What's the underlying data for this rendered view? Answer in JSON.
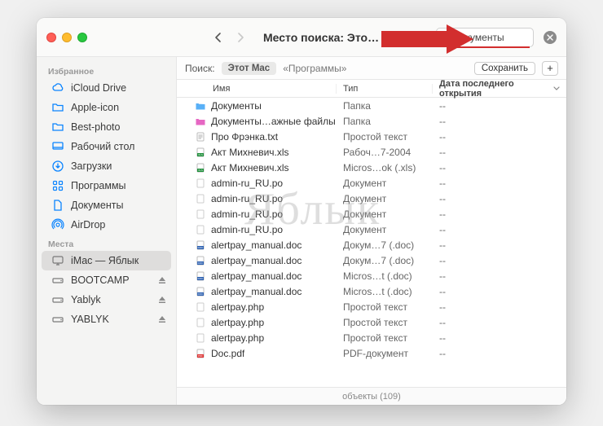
{
  "window": {
    "title": "Место поиска: Это…"
  },
  "search": {
    "value": "документы"
  },
  "scope": {
    "label": "Поиск:",
    "active": "Этот Mac",
    "other": "«Программы»",
    "save": "Сохранить"
  },
  "sidebar": {
    "sections": [
      {
        "title": "Избранное",
        "items": [
          {
            "label": "iCloud Drive",
            "icon": "cloud"
          },
          {
            "label": "Apple-icon",
            "icon": "folder"
          },
          {
            "label": "Best-photo",
            "icon": "folder"
          },
          {
            "label": "Рабочий стол",
            "icon": "desktop"
          },
          {
            "label": "Загрузки",
            "icon": "download"
          },
          {
            "label": "Программы",
            "icon": "apps"
          },
          {
            "label": "Документы",
            "icon": "docfolder"
          },
          {
            "label": "AirDrop",
            "icon": "airdrop"
          }
        ]
      },
      {
        "title": "Места",
        "items": [
          {
            "label": "iMac — Яблык",
            "icon": "imac",
            "active": true
          },
          {
            "label": "BOOTCAMP",
            "icon": "drive",
            "eject": true
          },
          {
            "label": "Yablyk",
            "icon": "drive",
            "eject": true
          },
          {
            "label": "YABLYK",
            "icon": "drive",
            "eject": true
          }
        ]
      }
    ]
  },
  "columns": {
    "name": "Имя",
    "type": "Тип",
    "date": "Дата последнего открытия"
  },
  "files": [
    {
      "name": "Документы",
      "type": "Папка",
      "date": "--",
      "icon": "folder-blue"
    },
    {
      "name": "Документы…ажные файлы",
      "type": "Папка",
      "date": "--",
      "icon": "folder-pink"
    },
    {
      "name": "Про Фрэнка.txt",
      "type": "Простой текст",
      "date": "--",
      "icon": "txt"
    },
    {
      "name": "Акт Михневич.xls",
      "type": "Рабоч…7-2004",
      "date": "--",
      "icon": "xls"
    },
    {
      "name": "Акт Михневич.xls",
      "type": "Micros…ok (.xls)",
      "date": "--",
      "icon": "xls"
    },
    {
      "name": "admin-ru_RU.po",
      "type": "Документ",
      "date": "--",
      "icon": "blank"
    },
    {
      "name": "admin-ru_RU.po",
      "type": "Документ",
      "date": "--",
      "icon": "blank"
    },
    {
      "name": "admin-ru_RU.po",
      "type": "Документ",
      "date": "--",
      "icon": "blank"
    },
    {
      "name": "admin-ru_RU.po",
      "type": "Документ",
      "date": "--",
      "icon": "blank"
    },
    {
      "name": "alertpay_manual.doc",
      "type": "Докум…7 (.doc)",
      "date": "--",
      "icon": "doc"
    },
    {
      "name": "alertpay_manual.doc",
      "type": "Докум…7 (.doc)",
      "date": "--",
      "icon": "doc"
    },
    {
      "name": "alertpay_manual.doc",
      "type": "Micros…t (.doc)",
      "date": "--",
      "icon": "doc"
    },
    {
      "name": "alertpay_manual.doc",
      "type": "Micros…t (.doc)",
      "date": "--",
      "icon": "doc"
    },
    {
      "name": "alertpay.php",
      "type": "Простой текст",
      "date": "--",
      "icon": "blank"
    },
    {
      "name": "alertpay.php",
      "type": "Простой текст",
      "date": "--",
      "icon": "blank"
    },
    {
      "name": "alertpay.php",
      "type": "Простой текст",
      "date": "--",
      "icon": "blank"
    },
    {
      "name": "Doc.pdf",
      "type": "PDF-документ",
      "date": "--",
      "icon": "pdf"
    }
  ],
  "status": "объекты (109)",
  "watermark": "Яблык"
}
